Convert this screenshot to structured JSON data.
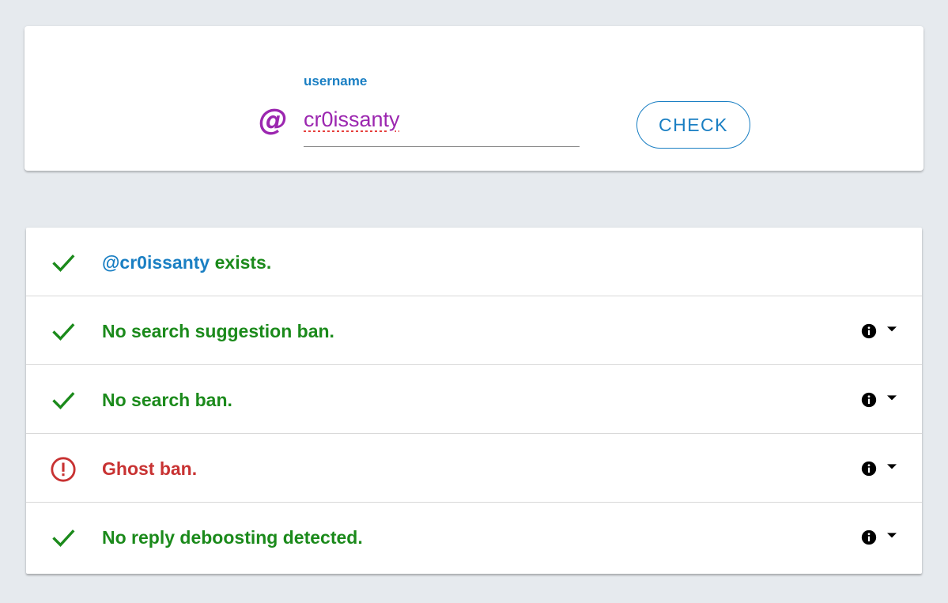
{
  "colors": {
    "background": "#e6eaee",
    "accent_blue": "#1a7fc3",
    "purple": "#9c27b0",
    "success_green": "#1b8a1b",
    "error_red": "#c83232"
  },
  "search": {
    "at_symbol": "@",
    "label": "username",
    "value": "cr0issanty",
    "check_label": "CHECK"
  },
  "results": [
    {
      "status": "ok",
      "icon": "check-icon",
      "handle": "@cr0issanty",
      "text": " exists.",
      "has_info": false
    },
    {
      "status": "ok",
      "icon": "check-icon",
      "text": "No search suggestion ban.",
      "has_info": true
    },
    {
      "status": "ok",
      "icon": "check-icon",
      "text": "No search ban.",
      "has_info": true
    },
    {
      "status": "bad",
      "icon": "alert-circle-icon",
      "text": "Ghost ban.",
      "has_info": true
    },
    {
      "status": "ok",
      "icon": "check-icon",
      "text": "No reply deboosting detected.",
      "has_info": true
    }
  ]
}
